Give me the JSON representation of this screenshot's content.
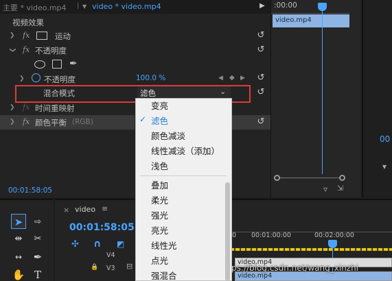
{
  "tabs": {
    "main": "主要 * video.mp4",
    "sequence": "video * video.mp4"
  },
  "section_title": "视频效果",
  "effects": {
    "motion": "运动",
    "opacity": "不透明度",
    "opacity_param": "不透明度",
    "opacity_value": "100.0 %",
    "blend_mode_label": "混合模式",
    "blend_mode_value": "滤色",
    "time_remap": "时间重映射",
    "color_balance": "颜色平衡",
    "color_balance_suffix": "(RGB)"
  },
  "timecode": "00:01:58:05",
  "mini_timeline": {
    "time": ":00:00",
    "clip": "video.mp4"
  },
  "program_partial": "00",
  "dropdown": {
    "options_top": [
      "变亮",
      "滤色",
      "颜色减淡",
      "线性减淡（添加）",
      "浅色"
    ],
    "options_bottom": [
      "叠加",
      "柔光",
      "强光",
      "亮光",
      "线性光",
      "点光",
      "强混合"
    ],
    "selected": "滤色"
  },
  "timeline": {
    "seq_name": "video",
    "timecode": "00:01:58:05",
    "ruler": [
      "00:01:00:00",
      "00:02:00:00"
    ],
    "tracks": [
      "V4",
      "V3"
    ],
    "clip1": "video.mp4",
    "clip2": "video.mp4"
  },
  "watermark": "https://blog.csdn.net/wang_xinzhi",
  "colors": {
    "accent": "#4aa3ff",
    "highlight_box": "#e03a3a",
    "clip": "#8db4e2"
  },
  "icons": [
    "fx-icon",
    "ellipse-icon",
    "rectangle-icon",
    "pen-icon",
    "reset-icon",
    "stopwatch-icon",
    "chevron-down-icon",
    "select-tool-icon",
    "track-select-icon",
    "ripple-icon",
    "razor-icon",
    "slip-icon",
    "pen-tool-icon",
    "hand-icon",
    "type-icon",
    "checkmark-icon"
  ]
}
